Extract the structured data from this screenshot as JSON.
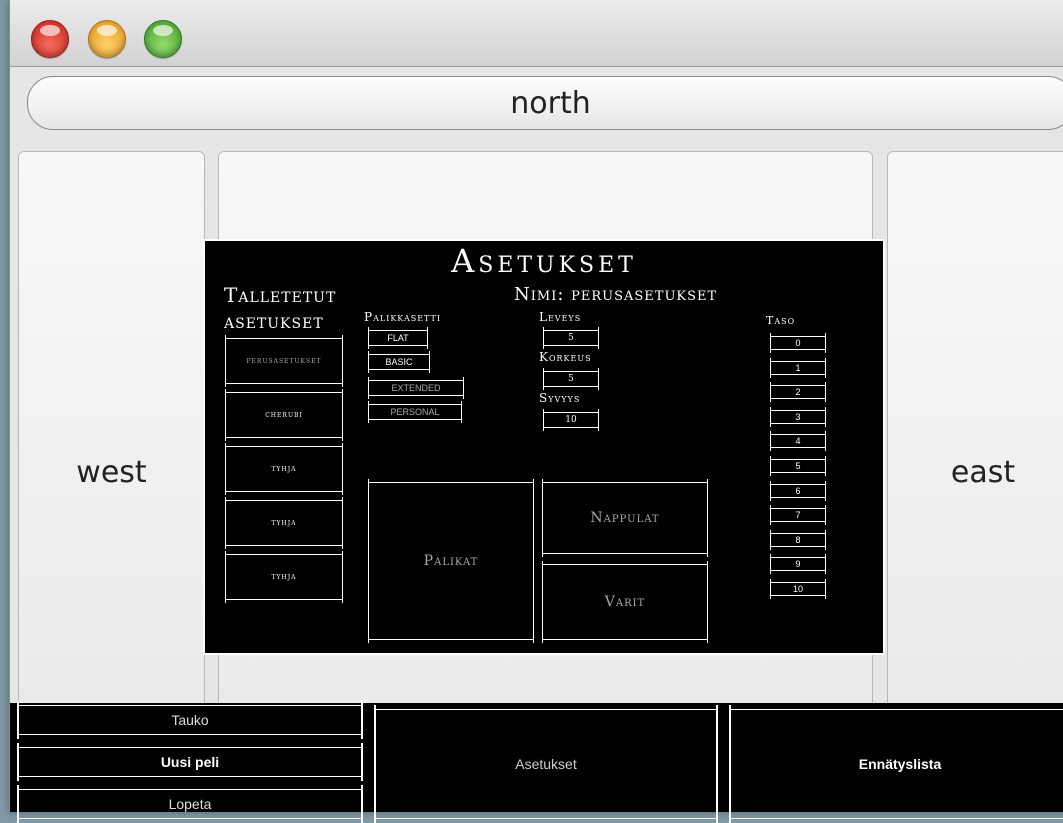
{
  "layout_labels": {
    "north": "north",
    "west": "west",
    "east": "east"
  },
  "dialog": {
    "title": "Asetukset",
    "saved_heading_1": "Talletetut",
    "saved_heading_2": "asetukset",
    "saved_slots": [
      "perusasetukset",
      "cherubi",
      "tyhja",
      "tyhja",
      "tyhja"
    ],
    "name_label": "Nimi: perusasetukset",
    "block_set_label": "Palikkasetti",
    "block_sets": [
      "FLAT",
      "BASIC",
      "EXTENDED",
      "PERSONAL"
    ],
    "width_label": "Leveys",
    "width_value": "5",
    "height_label": "Korkeus",
    "height_value": "5",
    "depth_label": "Syvyys",
    "depth_value": "10",
    "level_label": "Taso",
    "levels": [
      "0",
      "1",
      "2",
      "3",
      "4",
      "5",
      "6",
      "7",
      "8",
      "9",
      "10"
    ],
    "blocks_label": "Palikat",
    "pieces_label": "Nappulat",
    "colors_label": "Varit"
  },
  "bottom": {
    "pause": "Tauko",
    "new_game": "Uusi peli",
    "quit": "Lopeta",
    "settings": "Asetukset",
    "highscores": "Ennätyslista"
  }
}
